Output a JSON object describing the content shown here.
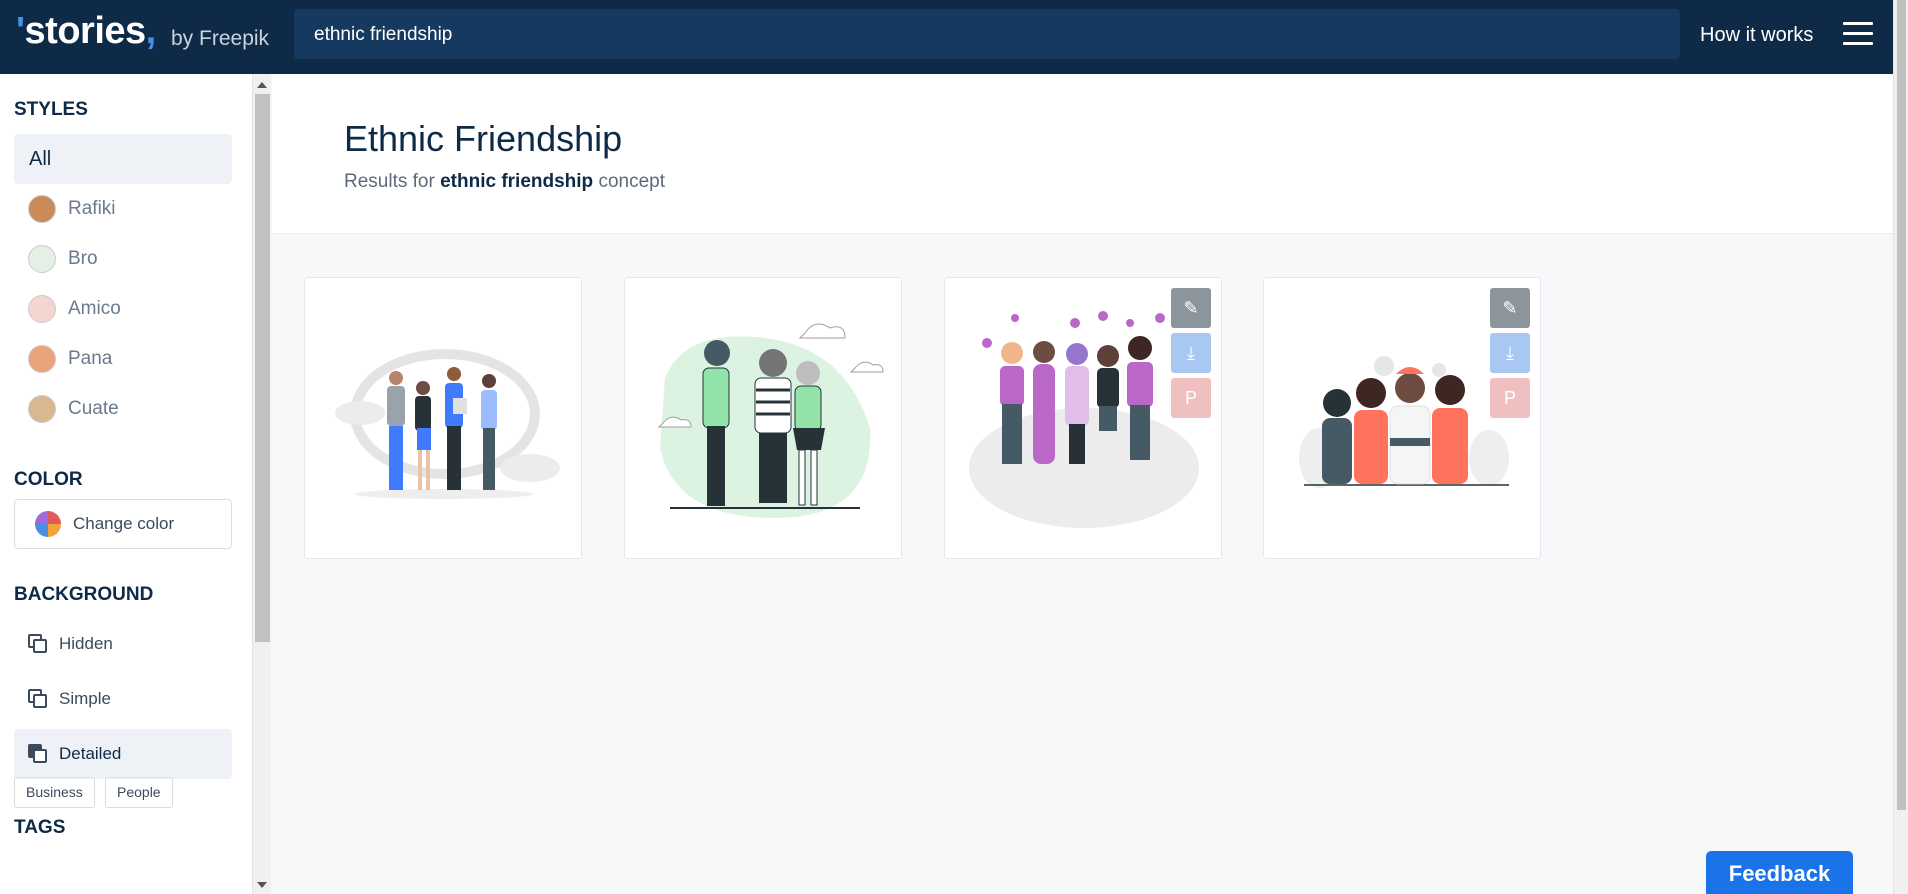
{
  "header": {
    "logo_text": "stories",
    "logo_by": "by Freepik",
    "search_value": "ethnic friendship",
    "how_it_works": "How it works"
  },
  "sidebar": {
    "styles_title": "STYLES",
    "styles": [
      {
        "label": "All",
        "active": true
      },
      {
        "label": "Rafiki",
        "avatar_color": "#c98b5a"
      },
      {
        "label": "Bro",
        "avatar_color": "#e6efe6"
      },
      {
        "label": "Amico",
        "avatar_color": "#f3d6cf"
      },
      {
        "label": "Pana",
        "avatar_color": "#e9a37d"
      },
      {
        "label": "Cuate",
        "avatar_color": "#d9b890"
      }
    ],
    "color_title": "COLOR",
    "change_color": "Change color",
    "background_title": "BACKGROUND",
    "backgrounds": [
      {
        "label": "Hidden"
      },
      {
        "label": "Simple"
      },
      {
        "label": "Detailed",
        "active": true
      }
    ],
    "tags_title": "TAGS",
    "tags": [
      "Business",
      "People"
    ]
  },
  "main": {
    "title": "Ethnic Friendship",
    "subtitle_prefix": "Results for",
    "subtitle_term": "ethnic friendship",
    "subtitle_suffix": "concept"
  },
  "cards": [
    {
      "accent": "#407bff",
      "actions": false
    },
    {
      "accent": "#92e3a9",
      "actions": false
    },
    {
      "accent": "#ba68c8",
      "actions": true
    },
    {
      "accent": "#ff725e",
      "actions": true
    }
  ],
  "feedback": "Feedback",
  "colors": {
    "header_bg": "#0e2a47",
    "search_bg": "#163a5f",
    "feedback_bg": "#1a73e8"
  }
}
